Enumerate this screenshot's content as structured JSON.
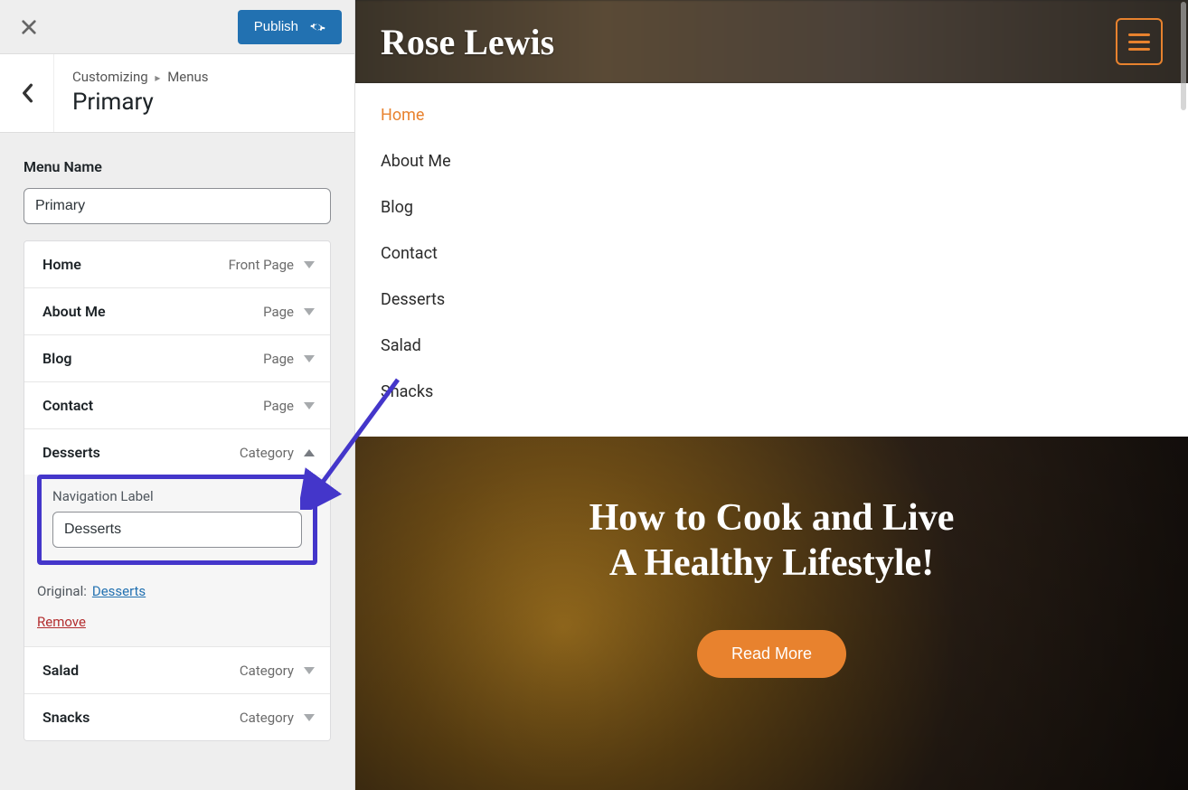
{
  "colors": {
    "accent": "#e8822e",
    "primary_blue": "#2271b1",
    "danger": "#b32d2e",
    "highlight": "#4436ca"
  },
  "customizer": {
    "publish_label": "Publish",
    "breadcrumb_root": "Customizing",
    "breadcrumb_section": "Menus",
    "breadcrumb_title": "Primary",
    "menu_name_label": "Menu Name",
    "menu_name_value": "Primary",
    "items": [
      {
        "label": "Home",
        "type": "Front Page",
        "expanded": false
      },
      {
        "label": "About Me",
        "type": "Page",
        "expanded": false
      },
      {
        "label": "Blog",
        "type": "Page",
        "expanded": false
      },
      {
        "label": "Contact",
        "type": "Page",
        "expanded": false
      },
      {
        "label": "Desserts",
        "type": "Category",
        "expanded": true,
        "nav_label_title": "Navigation Label",
        "nav_label_value": "Desserts",
        "original_label": "Original:",
        "original_link": "Desserts",
        "remove_label": "Remove"
      },
      {
        "label": "Salad",
        "type": "Category",
        "expanded": false
      },
      {
        "label": "Snacks",
        "type": "Category",
        "expanded": false
      }
    ]
  },
  "preview": {
    "brand": "Rose Lewis",
    "chef_badge_fragment": "◡┤┟┌",
    "nav": [
      {
        "label": "Home",
        "active": true
      },
      {
        "label": "About Me",
        "active": false
      },
      {
        "label": "Blog",
        "active": false
      },
      {
        "label": "Contact",
        "active": false
      },
      {
        "label": "Desserts",
        "active": false
      },
      {
        "label": "Salad",
        "active": false
      },
      {
        "label": "Snacks",
        "active": false
      }
    ],
    "hero_line1": "How to Cook and Live",
    "hero_line2": "A Healthy Lifestyle!",
    "read_more": "Read More"
  }
}
